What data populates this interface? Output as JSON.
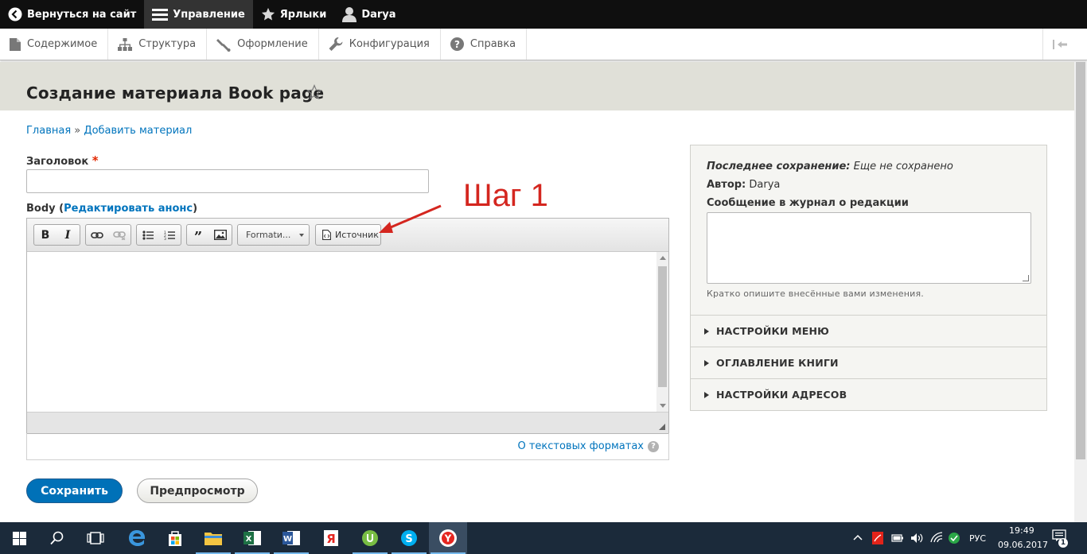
{
  "toolbar": {
    "back": "Вернуться на сайт",
    "manage": "Управление",
    "shortcuts": "Ярлыки",
    "user": "Darya"
  },
  "tray": {
    "items": [
      {
        "label": "Содержимое",
        "icon": "file-icon"
      },
      {
        "label": "Структура",
        "icon": "sitemap-icon"
      },
      {
        "label": "Оформление",
        "icon": "paintbrush-icon"
      },
      {
        "label": "Конфигурация",
        "icon": "wrench-icon"
      },
      {
        "label": "Справка",
        "icon": "help-icon"
      }
    ]
  },
  "page": {
    "title": "Создание материала Book page"
  },
  "breadcrumb": {
    "home": "Главная",
    "separator": "»",
    "current": "Добавить материал"
  },
  "form": {
    "title_label": "Заголовок",
    "required_mark": "*",
    "title_value": "",
    "body_label": "Body",
    "body_summary_link": "Редактировать анонс",
    "format_combo": "Formatи...",
    "source_button": "Источник",
    "text_formats_link": "О текстовых форматах",
    "save_button": "Сохранить",
    "preview_button": "Предпросмотр"
  },
  "annotation": {
    "text": "Шаг 1",
    "color": "#d4261f"
  },
  "sidebar": {
    "last_saved_label": "Последнее сохранение:",
    "last_saved_value": "Еще не сохранено",
    "author_label": "Автор:",
    "author_value": "Darya",
    "revision_label": "Сообщение в журнал о редакции",
    "revision_description": "Кратко опишите внесённые вами изменения.",
    "sections": [
      "НАСТРОЙКИ МЕНЮ",
      "ОГЛАВЛЕНИЕ КНИГИ",
      "НАСТРОЙКИ АДРЕСОВ"
    ]
  },
  "taskbar": {
    "language": "РУС",
    "time": "19:49",
    "date": "09.06.2017",
    "notifications": "1"
  },
  "colors": {
    "accent": "#0071b8",
    "link": "#0074bd",
    "header_bg": "#e0e0d8"
  }
}
